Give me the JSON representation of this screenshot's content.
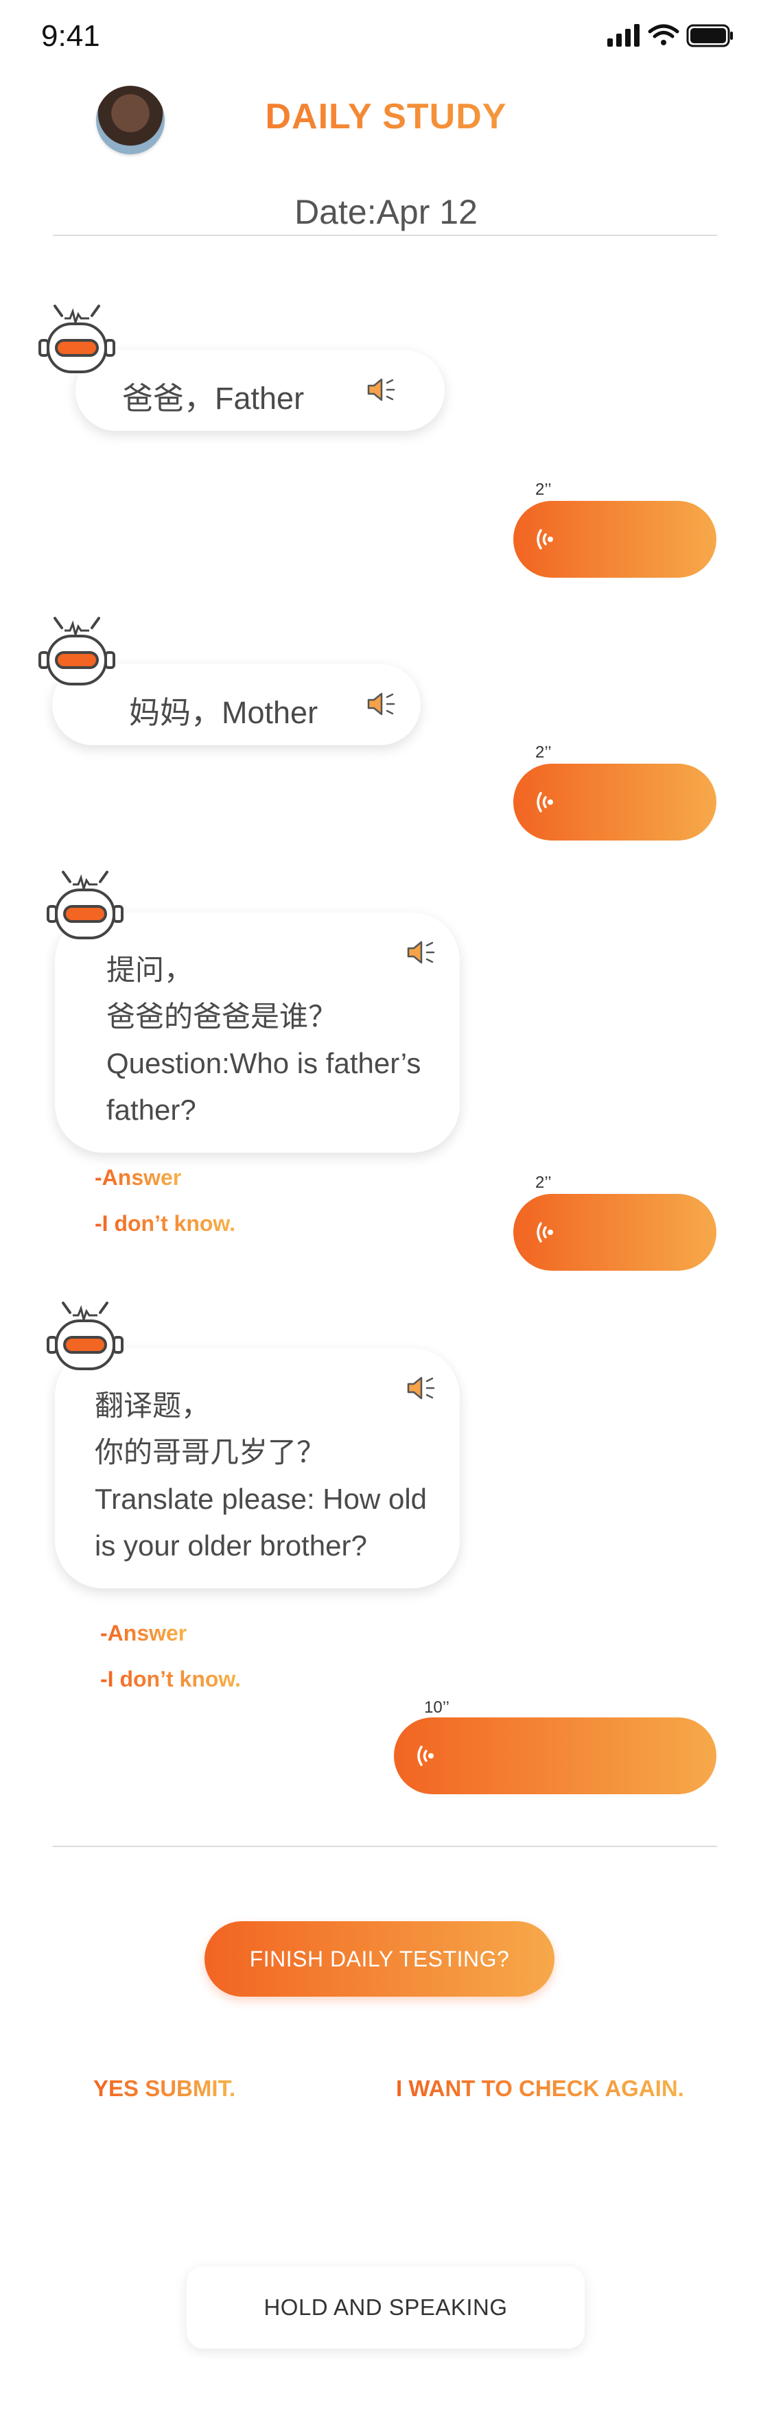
{
  "status_bar": {
    "time": "9:41"
  },
  "header": {
    "title": "DAILY STUDY",
    "date": "Date:Apr 12"
  },
  "messages": [
    {
      "bot_text": "爸爸，Father",
      "reply_duration": "2’’"
    },
    {
      "bot_text": "妈妈，Mother",
      "reply_duration": "2’’"
    },
    {
      "bot_lines": [
        "提问，",
        "爸爸的爸爸是谁？",
        "Question:Who is father’s",
        "father?"
      ],
      "answer_label": "-Answer",
      "idk_label": "-I don’t know.",
      "reply_duration": "2’’"
    },
    {
      "bot_lines": [
        "翻译题，",
        "你的哥哥几岁了？",
        "Translate please: How old",
        "is your older brother?"
      ],
      "answer_label": "-Answer",
      "idk_label": "-I don’t know.",
      "reply_duration": "10’’"
    }
  ],
  "footer": {
    "finish_label": "FINISH DAILY TESTING?",
    "yes_label": "YES SUBMIT.",
    "check_label": "I WANT TO CHECK AGAIN.",
    "hold_label": "HOLD AND SPEAKING"
  },
  "colors": {
    "accent_start": "#f26522",
    "accent_end": "#f6b24a",
    "text": "#4a4a4a"
  },
  "icons": [
    "signal-icon",
    "wifi-icon",
    "battery-icon",
    "robot-icon",
    "speaker-icon",
    "voice-wave-icon"
  ]
}
